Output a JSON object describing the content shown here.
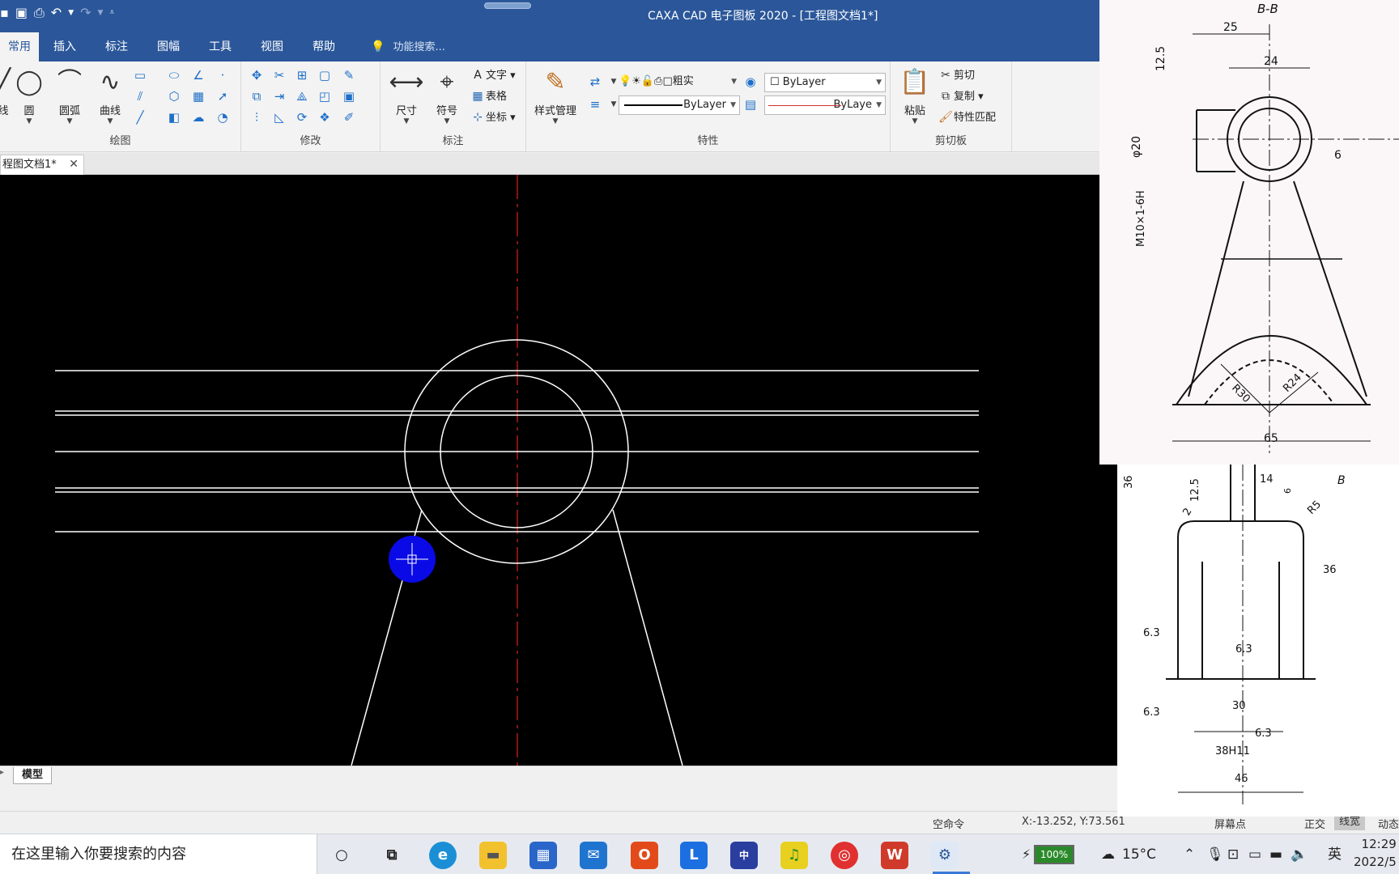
{
  "window": {
    "title": "CAXA CAD 电子图板 2020 - [工程图文档1*]"
  },
  "ribbon": {
    "tabs": [
      "常用",
      "插入",
      "标注",
      "图幅",
      "工具",
      "视图",
      "帮助"
    ],
    "tell_me": "功能搜索...",
    "draw": {
      "label": "绘图",
      "line_label": "线",
      "circle_label": "圆",
      "arc_label": "圆弧",
      "curve_label": "曲线"
    },
    "modify": {
      "label": "修改"
    },
    "annotate": {
      "label": "标注",
      "dimension_label": "尺寸",
      "symbol_label": "符号",
      "text_label": "文字",
      "table_label": "表格",
      "coord_label": "坐标"
    },
    "properties": {
      "label": "特性",
      "style_mgr_label": "样式管理",
      "line_style": "粗实",
      "color_value": "ByLayer",
      "linetype_value": "ByLayer",
      "lineweight_value": "ByLaye"
    },
    "clipboard": {
      "label": "剪切板",
      "paste_label": "粘贴",
      "cut_label": "剪切",
      "copy_label": "复制",
      "match_label": "特性匹配"
    }
  },
  "document_tab": {
    "title": "程图文档1*"
  },
  "layout_tab": {
    "label": "模型"
  },
  "status": {
    "command": "空命令",
    "coords": "X:-13.252, Y:73.561",
    "snap": "屏幕点",
    "ortho": "正交",
    "lineweight": "线宽",
    "dynamic": "动态"
  },
  "reference": {
    "view_title": "B-B",
    "top_dims": [
      "25",
      "24",
      "12.5",
      "φ20",
      "6",
      "M10×1-6H",
      "R30",
      "R24",
      "65"
    ],
    "bottom_dims": [
      "36",
      "12.5",
      "14",
      "6",
      "B",
      "2",
      "R5",
      "36",
      "6.3",
      "6.3",
      "6.3",
      "30",
      "6.3",
      "38H11",
      "46"
    ]
  },
  "taskbar": {
    "search_placeholder": "在这里输入你要搜索的内容",
    "battery": "100%",
    "temperature": "15°C",
    "ime": "英",
    "time": "12:29",
    "date": "2022/5"
  },
  "colors": {
    "title_bar": "#2b579a",
    "canvas": "#000000",
    "centerline": "#e02020",
    "marker": "#0a0ae6"
  }
}
